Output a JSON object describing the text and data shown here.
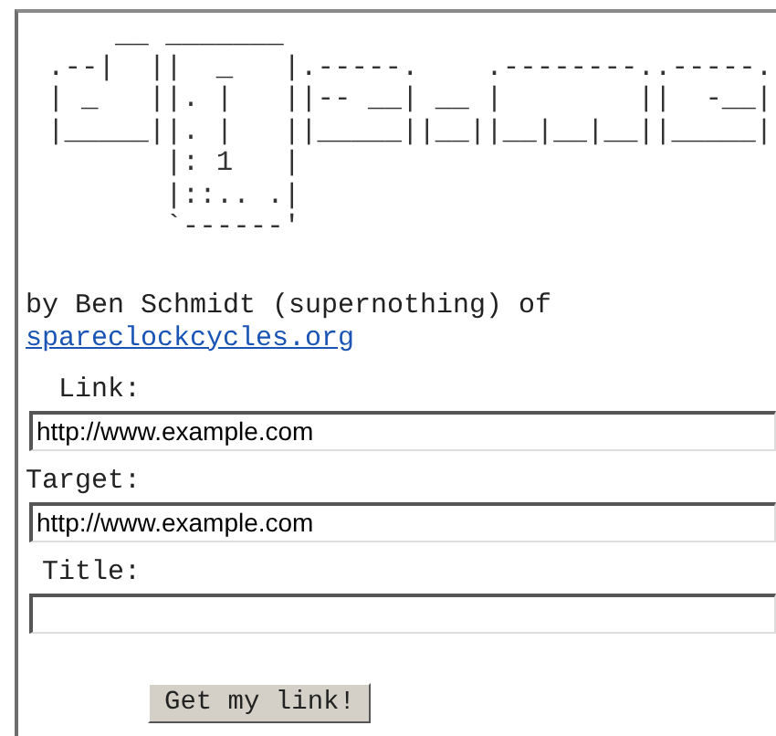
{
  "logo_ascii": [
    "    __ _______",
    ".--|  ||  _   |.-----.    .--------..-----.",
    "| _   ||. |   ||-- __| __ |        ||  -__|",
    "|_____||. |   ||_____||__||__|__|__||_____|",
    "       |: 1   |",
    "       |::.. .|",
    "       `------'"
  ],
  "byline": "by Ben Schmidt (supernothing) of",
  "site_link": "spareclockcycles.org",
  "fields": [
    {
      "label": "Link:",
      "value": "http://www.example.com"
    },
    {
      "label": "Target:",
      "value": "http://www.example.com"
    },
    {
      "label": "Title:"
    }
  ],
  "submit_button": "Get my link!"
}
